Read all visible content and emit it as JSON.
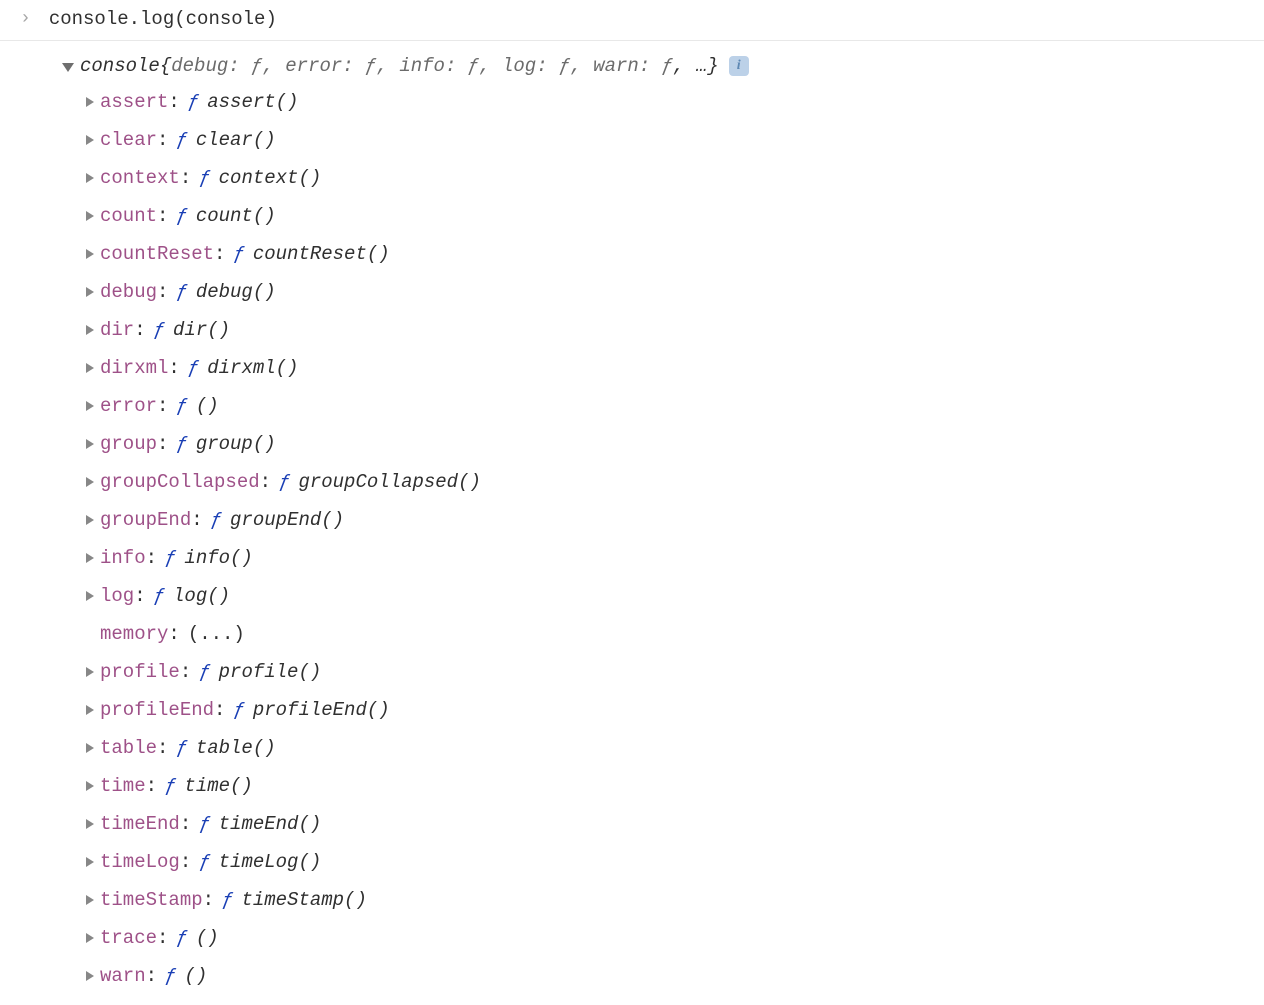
{
  "input": {
    "prompt_marker": "›",
    "command": "console.log(console)"
  },
  "output": {
    "object_name": "console",
    "preview_text_open": " {",
    "preview_text_close": ", …}",
    "preview_items": [
      {
        "key": "debug",
        "val": "ƒ"
      },
      {
        "key": "error",
        "val": "ƒ"
      },
      {
        "key": "info",
        "val": "ƒ"
      },
      {
        "key": "log",
        "val": "ƒ"
      },
      {
        "key": "warn",
        "val": "ƒ"
      }
    ],
    "info_label": "i",
    "properties": [
      {
        "key": "assert",
        "fn_marker": "ƒ",
        "fn_display": "assert()",
        "has_arrow": true
      },
      {
        "key": "clear",
        "fn_marker": "ƒ",
        "fn_display": "clear()",
        "has_arrow": true
      },
      {
        "key": "context",
        "fn_marker": "ƒ",
        "fn_display": "context()",
        "has_arrow": true
      },
      {
        "key": "count",
        "fn_marker": "ƒ",
        "fn_display": "count()",
        "has_arrow": true
      },
      {
        "key": "countReset",
        "fn_marker": "ƒ",
        "fn_display": "countReset()",
        "has_arrow": true
      },
      {
        "key": "debug",
        "fn_marker": "ƒ",
        "fn_display": "debug()",
        "has_arrow": true
      },
      {
        "key": "dir",
        "fn_marker": "ƒ",
        "fn_display": "dir()",
        "has_arrow": true
      },
      {
        "key": "dirxml",
        "fn_marker": "ƒ",
        "fn_display": "dirxml()",
        "has_arrow": true
      },
      {
        "key": "error",
        "fn_marker": "ƒ",
        "fn_display": "()",
        "has_arrow": true
      },
      {
        "key": "group",
        "fn_marker": "ƒ",
        "fn_display": "group()",
        "has_arrow": true
      },
      {
        "key": "groupCollapsed",
        "fn_marker": "ƒ",
        "fn_display": "groupCollapsed()",
        "has_arrow": true
      },
      {
        "key": "groupEnd",
        "fn_marker": "ƒ",
        "fn_display": "groupEnd()",
        "has_arrow": true
      },
      {
        "key": "info",
        "fn_marker": "ƒ",
        "fn_display": "info()",
        "has_arrow": true
      },
      {
        "key": "log",
        "fn_marker": "ƒ",
        "fn_display": "log()",
        "has_arrow": true
      },
      {
        "key": "memory",
        "fn_marker": "",
        "fn_display": "(...)",
        "has_arrow": false
      },
      {
        "key": "profile",
        "fn_marker": "ƒ",
        "fn_display": "profile()",
        "has_arrow": true
      },
      {
        "key": "profileEnd",
        "fn_marker": "ƒ",
        "fn_display": "profileEnd()",
        "has_arrow": true
      },
      {
        "key": "table",
        "fn_marker": "ƒ",
        "fn_display": "table()",
        "has_arrow": true
      },
      {
        "key": "time",
        "fn_marker": "ƒ",
        "fn_display": "time()",
        "has_arrow": true
      },
      {
        "key": "timeEnd",
        "fn_marker": "ƒ",
        "fn_display": "timeEnd()",
        "has_arrow": true
      },
      {
        "key": "timeLog",
        "fn_marker": "ƒ",
        "fn_display": "timeLog()",
        "has_arrow": true
      },
      {
        "key": "timeStamp",
        "fn_marker": "ƒ",
        "fn_display": "timeStamp()",
        "has_arrow": true
      },
      {
        "key": "trace",
        "fn_marker": "ƒ",
        "fn_display": "()",
        "has_arrow": true
      },
      {
        "key": "warn",
        "fn_marker": "ƒ",
        "fn_display": "()",
        "has_arrow": true
      }
    ]
  }
}
